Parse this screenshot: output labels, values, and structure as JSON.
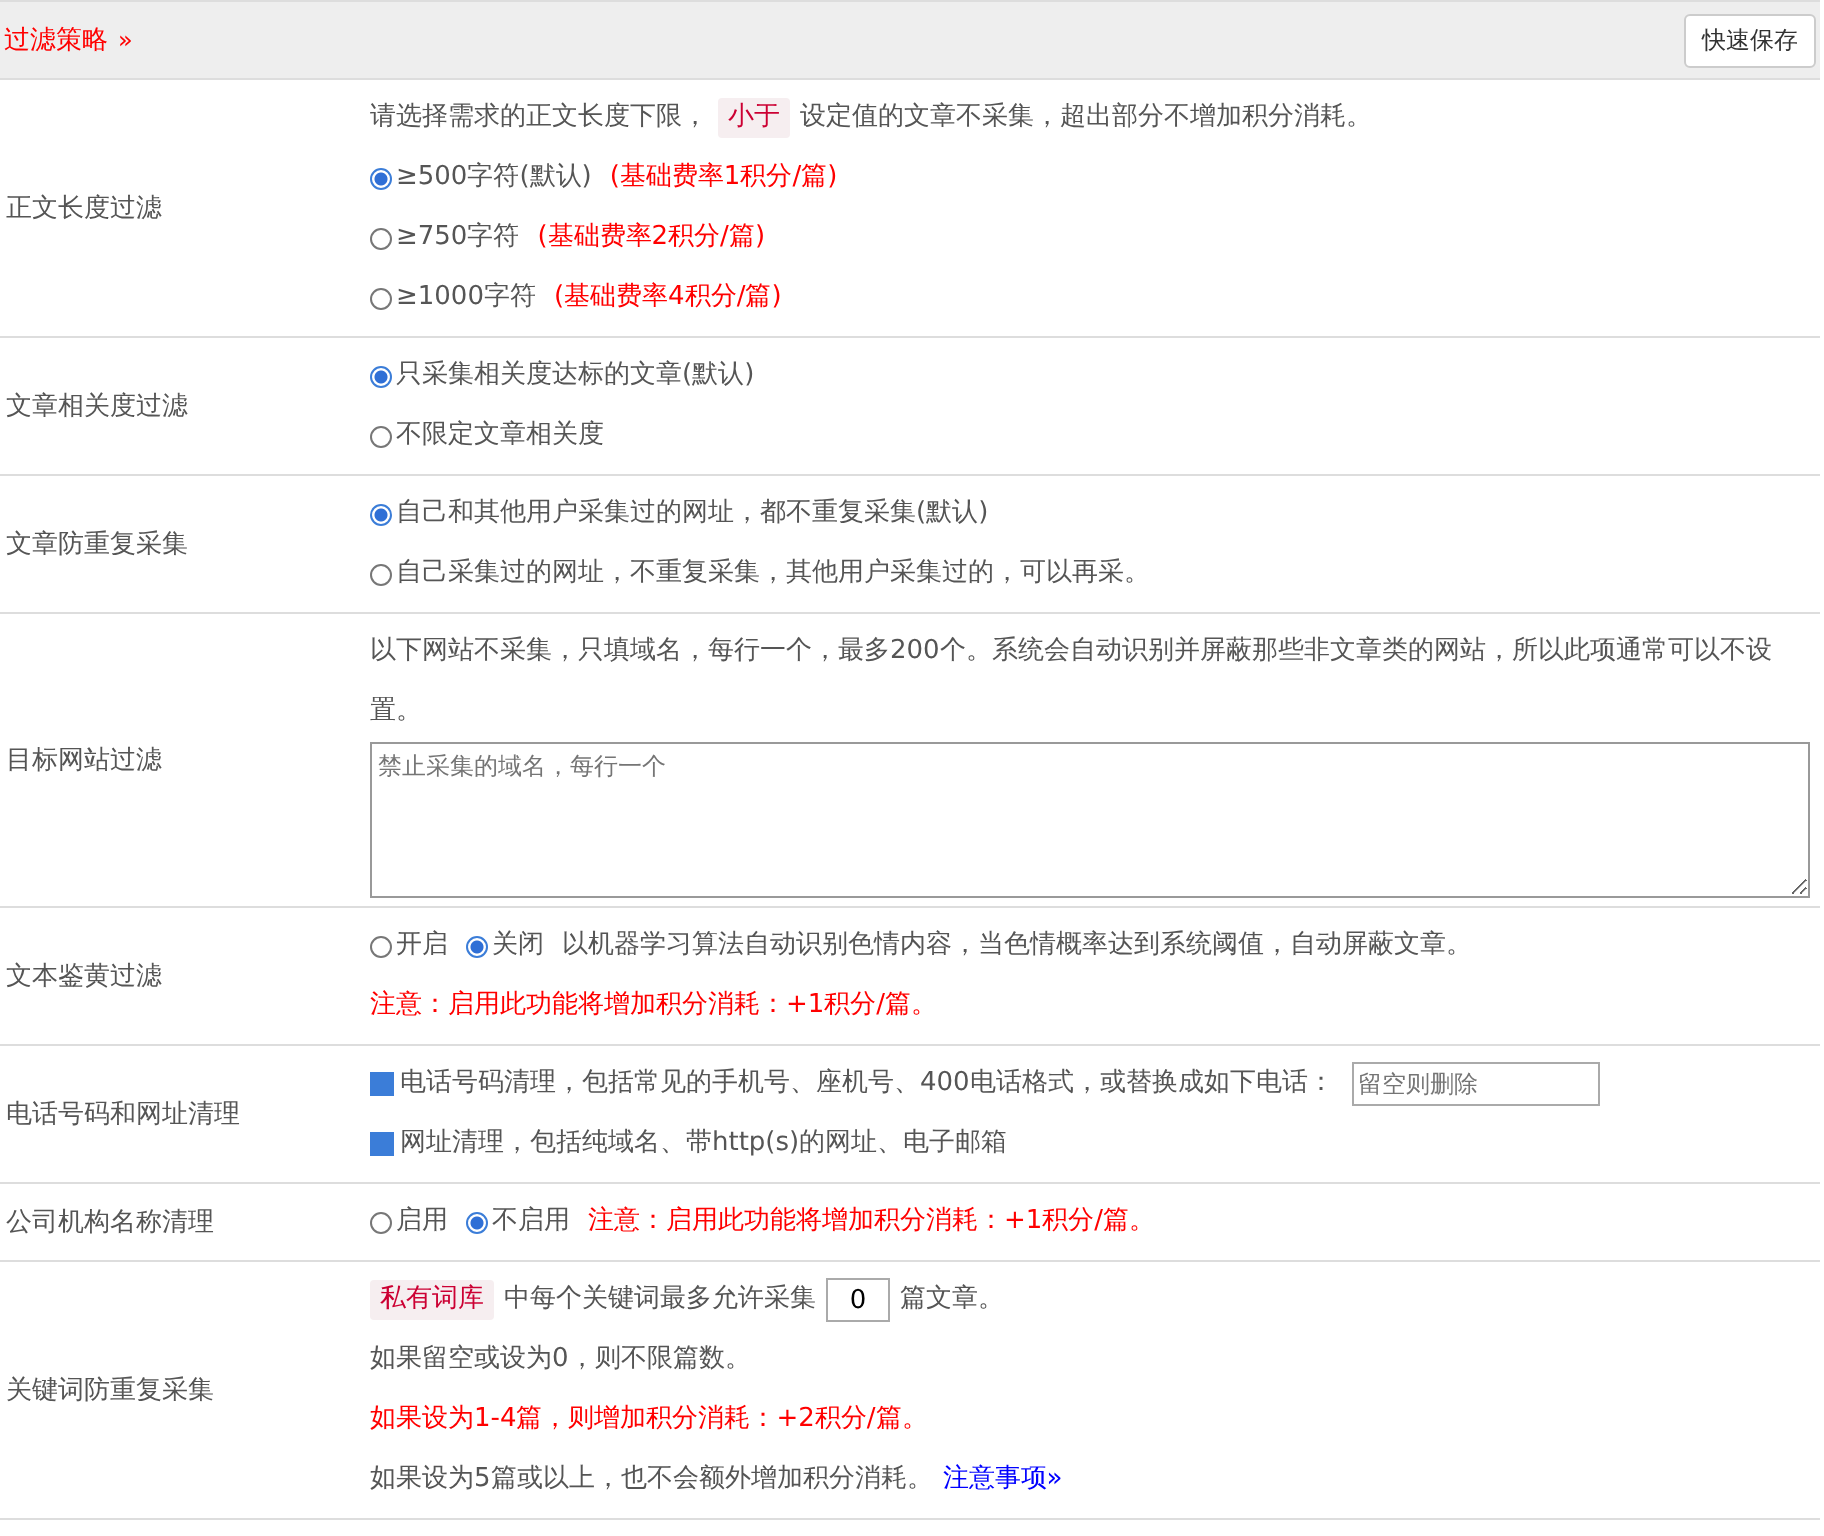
{
  "header": {
    "title": "过滤策略",
    "toggle": "»",
    "button": "快速保存"
  },
  "rows": [
    {
      "label": "正文长度过滤",
      "lines": [
        [
          {
            "kind": "text",
            "text": "请选择需求的正文长度下限，"
          },
          {
            "kind": "tag",
            "text": "小于"
          },
          {
            "kind": "text",
            "text": "设定值的文章不采集，超出部分不增加积分消耗。"
          }
        ],
        [
          {
            "kind": "radio",
            "text": "≥500字符(默认)",
            "selected": true
          },
          {
            "kind": "note",
            "text": "(基础费率1积分/篇)"
          }
        ],
        [
          {
            "kind": "radio",
            "text": "≥750字符",
            "selected": false
          },
          {
            "kind": "note",
            "text": "(基础费率2积分/篇)"
          }
        ],
        [
          {
            "kind": "radio",
            "text": "≥1000字符",
            "selected": false
          },
          {
            "kind": "note",
            "text": "(基础费率4积分/篇)"
          }
        ]
      ]
    },
    {
      "label": "文章相关度过滤",
      "lines": [
        [
          {
            "kind": "radio",
            "text": "只采集相关度达标的文章(默认)",
            "selected": true
          }
        ],
        [
          {
            "kind": "radio",
            "text": "不限定文章相关度",
            "selected": false
          }
        ]
      ]
    },
    {
      "label": "文章防重复采集",
      "lines": [
        [
          {
            "kind": "radio",
            "text": "自己和其他用户采集过的网址，都不重复采集(默认)",
            "selected": true
          }
        ],
        [
          {
            "kind": "radio",
            "text": "自己采集过的网址，不重复采集，其他用户采集过的，可以再采。",
            "selected": false
          }
        ]
      ]
    },
    {
      "label": "目标网站过滤",
      "lines": [
        [
          {
            "kind": "text",
            "text": "以下网站不采集，只填域名，每行一个，最多200个。系统会自动识别并屏蔽那些非文章类的网站，所以此项通常可以不设置。"
          }
        ],
        [
          {
            "kind": "textarea",
            "placeholder": "禁止采集的域名，每行一个"
          }
        ]
      ]
    },
    {
      "label": "文本鉴黄过滤",
      "lines": [
        [
          {
            "kind": "radio",
            "text": "开启",
            "selected": false
          },
          {
            "kind": "radio",
            "text": "关闭",
            "selected": true
          },
          {
            "kind": "text",
            "text": "以机器学习算法自动识别色情内容，当色情概率达到系统阈值，自动屏蔽文章。"
          }
        ],
        [
          {
            "kind": "note",
            "text": "注意：启用此功能将增加积分消耗：+1积分/篇。"
          }
        ]
      ]
    },
    {
      "label": "电话号码和网址清理",
      "lines": [
        [
          {
            "kind": "checkbox",
            "text": "电话号码清理，包括常见的手机号、座机号、400电话格式，或替换成如下电话：",
            "checked": true
          },
          {
            "kind": "input",
            "placeholder": "留空则删除"
          }
        ],
        [
          {
            "kind": "checkbox",
            "text": "网址清理，包括纯域名、带http(s)的网址、电子邮箱",
            "checked": true
          }
        ]
      ]
    },
    {
      "label": "公司机构名称清理",
      "lines": [
        [
          {
            "kind": "radio",
            "text": "启用",
            "selected": false
          },
          {
            "kind": "radio",
            "text": "不启用",
            "selected": true
          },
          {
            "kind": "note",
            "text": "注意：启用此功能将增加积分消耗：+1积分/篇。"
          }
        ]
      ]
    },
    {
      "label": "关键词防重复采集",
      "lines": [
        [
          {
            "kind": "tag",
            "text": "私有词库"
          },
          {
            "kind": "text",
            "text": "中每个关键词最多允许采集"
          },
          {
            "kind": "input",
            "value": "0"
          },
          {
            "kind": "text",
            "text": "篇文章。"
          }
        ],
        [
          {
            "kind": "text",
            "text": "如果留空或设为0，则不限篇数。"
          }
        ],
        [
          {
            "kind": "note",
            "text": "如果设为1-4篇，则增加积分消耗：+2积分/篇。"
          }
        ],
        [
          {
            "kind": "text",
            "text": "如果设为5篇或以上，也不会额外增加积分消耗。"
          },
          {
            "kind": "link",
            "text": "注意事项»"
          }
        ]
      ]
    }
  ]
}
